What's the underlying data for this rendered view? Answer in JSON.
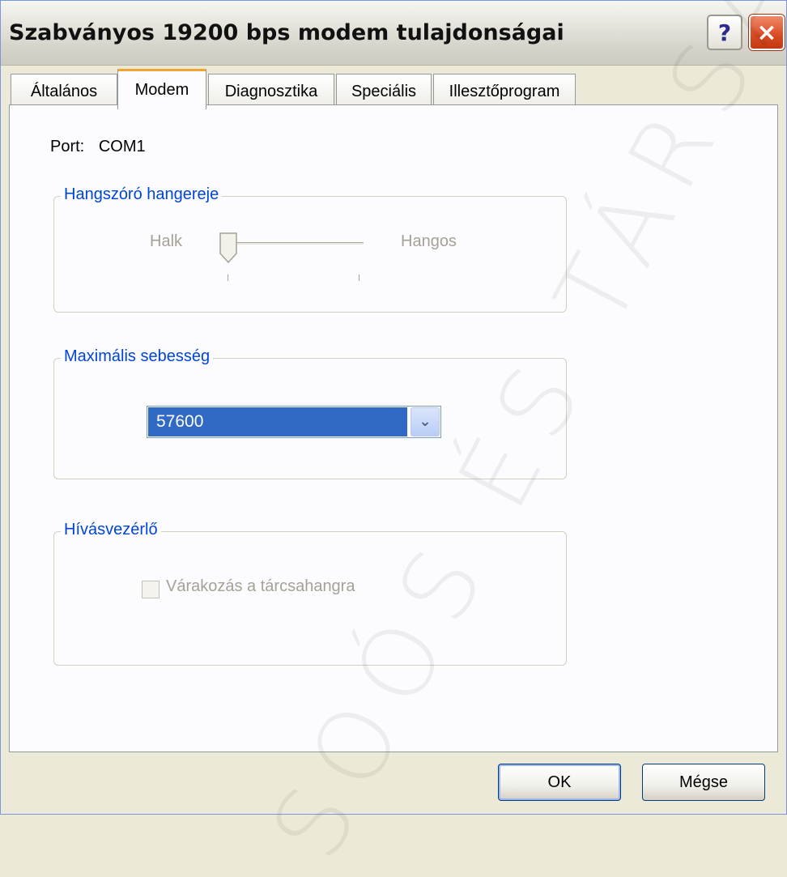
{
  "window": {
    "title": "Szabványos 19200 bps modem tulajdonságai",
    "help_glyph": "?",
    "close_glyph": "×"
  },
  "tabs": [
    {
      "label": "Általános"
    },
    {
      "label": "Modem",
      "active": true
    },
    {
      "label": "Diagnosztika"
    },
    {
      "label": "Speciális"
    },
    {
      "label": "Illesztőprogram"
    }
  ],
  "port": {
    "label": "Port:",
    "value": "COM1"
  },
  "speaker_volume": {
    "title": "Hangszóró hangereje",
    "min_label": "Halk",
    "max_label": "Hangos",
    "level": 0,
    "enabled": false
  },
  "max_speed": {
    "title": "Maximális sebesség",
    "selected": "57600"
  },
  "dial_control": {
    "title": "Hívásvezérlő",
    "wait_for_dial_tone_label": "Várakozás a tárcsahangra",
    "checked": false,
    "enabled": false
  },
  "buttons": {
    "ok": "OK",
    "cancel": "Mégse"
  },
  "watermark": {
    "text": "SOÓS ÉS TÁRSA"
  },
  "colors": {
    "group_title": "#0046d5",
    "selection": "#316ac5",
    "dialog_background": "#ece9d8",
    "tab_accent": "#f0a530",
    "close_button": "#d94a22"
  }
}
